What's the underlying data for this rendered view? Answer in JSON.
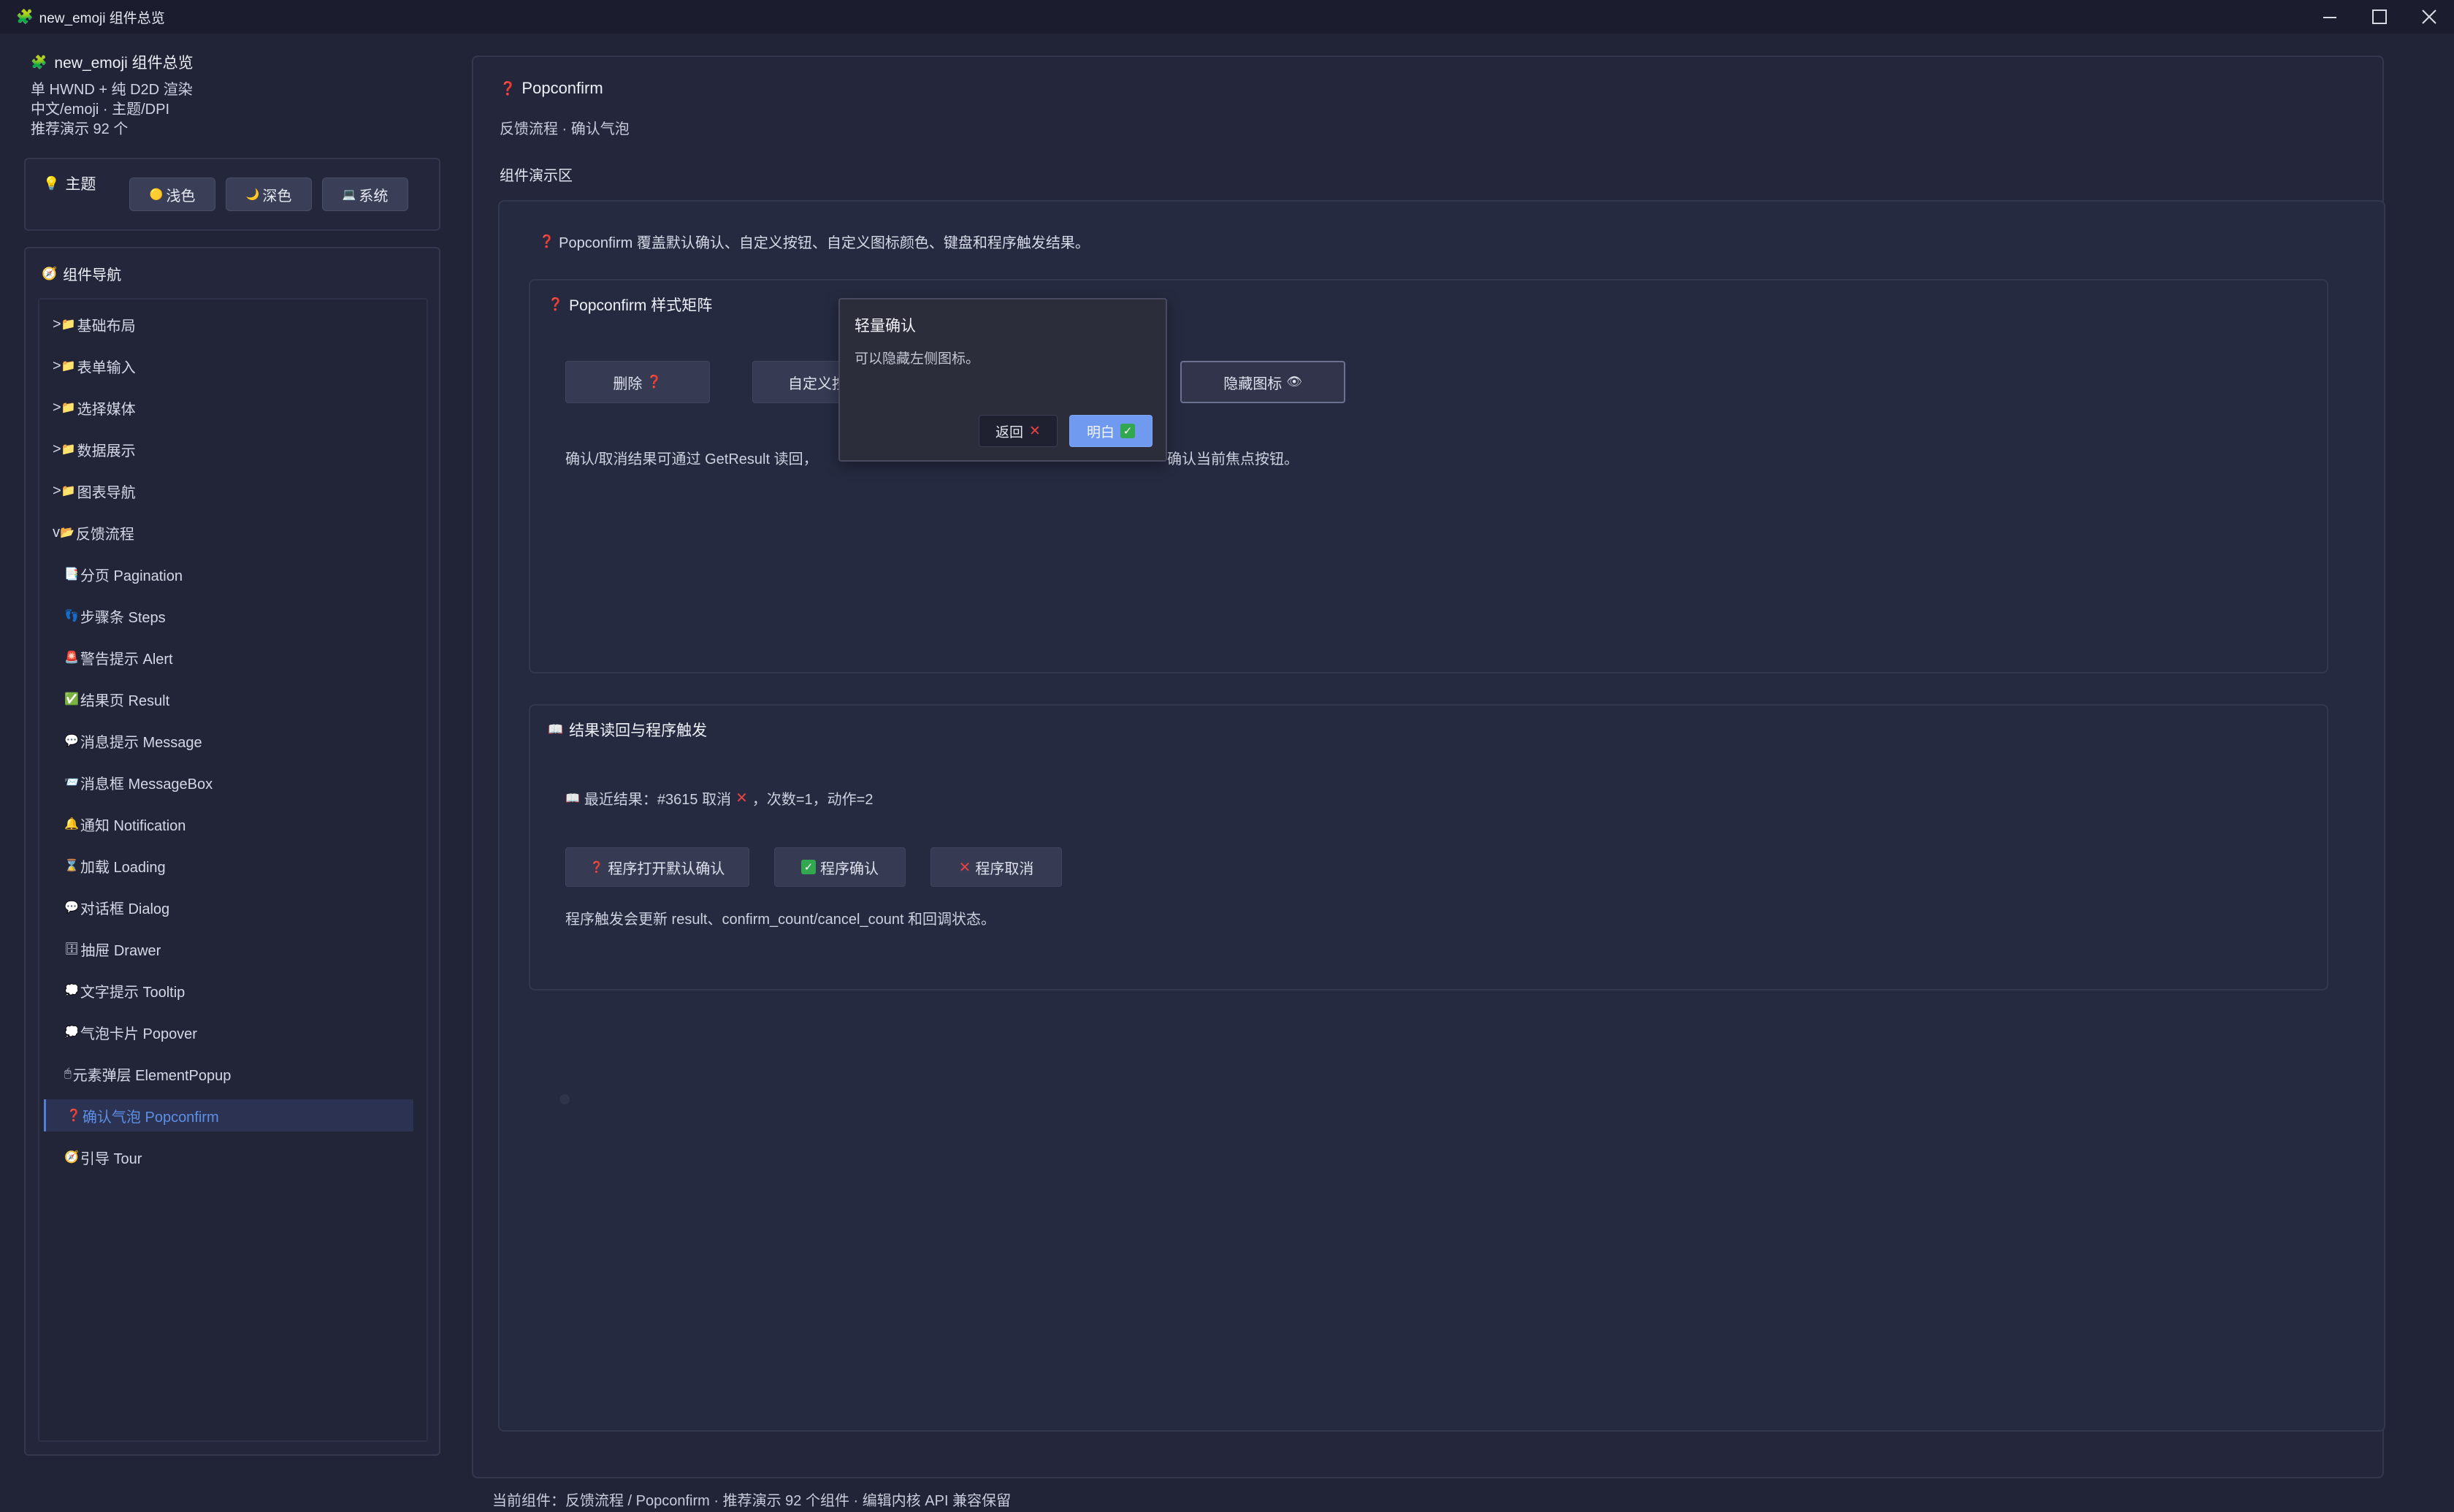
{
  "window": {
    "title": "new_emoji 组件总览",
    "app_icon": "🧩",
    "controls": [
      "minimize",
      "maximize",
      "close"
    ]
  },
  "sidebar": {
    "app_name": "new_emoji 组件总览",
    "info_lines": [
      "单 HWND + 纯 D2D 渲染",
      "中文/emoji · 主题/DPI",
      "推荐演示 92 个"
    ],
    "theme": {
      "label": "主题",
      "buttons": [
        {
          "icon": "🟡",
          "label": "浅色"
        },
        {
          "icon": "🌙",
          "label": "深色"
        },
        {
          "icon": "💻",
          "label": "系统"
        }
      ]
    },
    "nav": {
      "label": "组件导航",
      "items": [
        {
          "prefix": ">",
          "icon": "📁",
          "label": "基础布局"
        },
        {
          "prefix": ">",
          "icon": "📁",
          "label": "表单输入"
        },
        {
          "prefix": ">",
          "icon": "📁",
          "label": "选择媒体"
        },
        {
          "prefix": ">",
          "icon": "📁",
          "label": "数据展示"
        },
        {
          "prefix": ">",
          "icon": "📁",
          "label": "图表导航"
        },
        {
          "prefix": "v",
          "icon": "📂",
          "label": "反馈流程"
        },
        {
          "prefix": "",
          "icon": "📑",
          "label": "分页 Pagination"
        },
        {
          "prefix": "",
          "icon": "👣",
          "label": "步骤条 Steps"
        },
        {
          "prefix": "",
          "icon": "🚨",
          "label": "警告提示 Alert"
        },
        {
          "prefix": "",
          "icon": "✅",
          "label": "结果页 Result"
        },
        {
          "prefix": "",
          "icon": "💬",
          "label": "消息提示 Message"
        },
        {
          "prefix": "",
          "icon": "📨",
          "label": "消息框 MessageBox"
        },
        {
          "prefix": "",
          "icon": "🔔",
          "label": "通知 Notification"
        },
        {
          "prefix": "",
          "icon": "⌛",
          "label": "加载 Loading"
        },
        {
          "prefix": "",
          "icon": "💬",
          "label": "对话框 Dialog"
        },
        {
          "prefix": "",
          "icon": "🗄",
          "label": "抽屉 Drawer"
        },
        {
          "prefix": "",
          "icon": "💭",
          "label": "文字提示 Tooltip"
        },
        {
          "prefix": "",
          "icon": "💭",
          "label": "气泡卡片 Popover"
        },
        {
          "prefix": "",
          "icon": "🖱",
          "label": "元素弹层 ElementPopup"
        },
        {
          "prefix": "",
          "icon": "❓",
          "label": "确认气泡 Popconfirm"
        },
        {
          "prefix": "",
          "icon": "🧭",
          "label": "引导 Tour"
        }
      ],
      "active_label": "确认气泡 Popconfirm"
    }
  },
  "main": {
    "page_title": "Popconfirm",
    "page_icon": "❓",
    "breadcrumb": "反馈流程 · 确认气泡",
    "demo_label": "组件演示区",
    "intro": "Popconfirm 覆盖默认确认、自定义按钮、自定义图标颜色、键盘和程序触发结果。",
    "style_matrix": {
      "title": "Popconfirm 样式矩阵",
      "buttons": [
        {
          "label": "删除",
          "icon": "❓"
        },
        {
          "label": "自定义按",
          "icon": ""
        },
        {
          "label": "隐藏图标",
          "icon": "👁"
        }
      ],
      "note_left": "确认/取消结果可通过 GetResult 读回，",
      "note_right": "确认当前焦点按钮。"
    },
    "popconfirm": {
      "title": "轻量确认",
      "description": "可以隐藏左侧图标。",
      "cancel_label": "返回",
      "confirm_label": "明白"
    },
    "result_section": {
      "title": "结果读回与程序触发",
      "icon": "📖",
      "latest_prefix": "最近结果：#3615 取消",
      "latest_suffix": "，次数=1，动作=2",
      "buttons": [
        {
          "icon": "❓",
          "label": "程序打开默认确认"
        },
        {
          "icon": "✅",
          "label": "程序确认"
        },
        {
          "icon": "❌",
          "label": "程序取消"
        }
      ],
      "note": "程序触发会更新 result、confirm_count/cancel_count 和回调状态。"
    }
  },
  "status_bar": "当前组件：反馈流程 / Popconfirm · 推荐演示 92 个组件 · 编辑内核 API 兼容保留",
  "colors": {
    "background": "#212337",
    "panel": "#24273b",
    "accent": "#5d8fe6",
    "confirm_button": "#6f9af0",
    "danger": "#e64343"
  }
}
